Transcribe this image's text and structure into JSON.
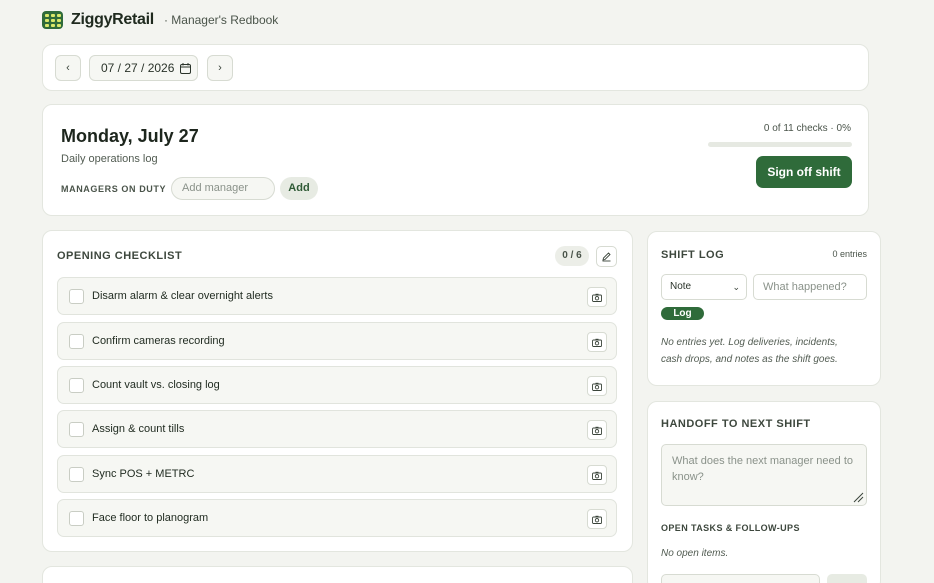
{
  "app": {
    "brand": "ZiggyRetail",
    "subtitle": "· Manager's Redbook"
  },
  "date_nav": {
    "prev_icon": "chevron-left-icon",
    "prev_glyph": "‹",
    "date_value": "07 / 27 / 2026",
    "calendar_icon": "calendar-icon",
    "next_icon": "chevron-right-icon",
    "next_glyph": "›"
  },
  "day": {
    "title": "Monday, July 27",
    "subtitle": "Daily operations log",
    "managers_label": "MANAGERS ON DUTY",
    "manager_placeholder": "Add manager",
    "add_label": "Add",
    "progress_text": "0 of 11 checks · 0%",
    "progress_fraction": 0,
    "signoff_label": "Sign off shift"
  },
  "checklist": {
    "title": "OPENING CHECKLIST",
    "count": "0 / 6",
    "edit_icon": "pencil-icon",
    "items": [
      {
        "label": "Disarm alarm & clear overnight alerts",
        "checked": false,
        "icon": "camera-icon"
      },
      {
        "label": "Confirm cameras recording",
        "checked": false,
        "icon": "camera-icon"
      },
      {
        "label": "Count vault vs. closing log",
        "checked": false,
        "icon": "camera-icon"
      },
      {
        "label": "Assign & count tills",
        "checked": false,
        "icon": "camera-icon"
      },
      {
        "label": "Sync POS + METRC",
        "checked": false,
        "icon": "camera-icon"
      },
      {
        "label": "Face floor to planogram",
        "checked": false,
        "icon": "camera-icon"
      }
    ]
  },
  "shift_log": {
    "title": "SHIFT LOG",
    "entries": "0 entries",
    "type_value": "Note",
    "input_placeholder": "What happened?",
    "log_label": "Log",
    "empty_line1": "No entries yet. Log deliveries, incidents,",
    "empty_line2": "cash drops, and notes as the shift goes."
  },
  "handoff": {
    "title": "HANDOFF TO NEXT SHIFT",
    "placeholder": "What does the next manager need to know?",
    "tasks_label": "OPEN TASKS & FOLLOW-UPS",
    "tasks_empty": "No open items."
  },
  "colors": {
    "brand_green": "#2f6b3a",
    "background": "#f3f4f0",
    "card": "#ffffff"
  }
}
